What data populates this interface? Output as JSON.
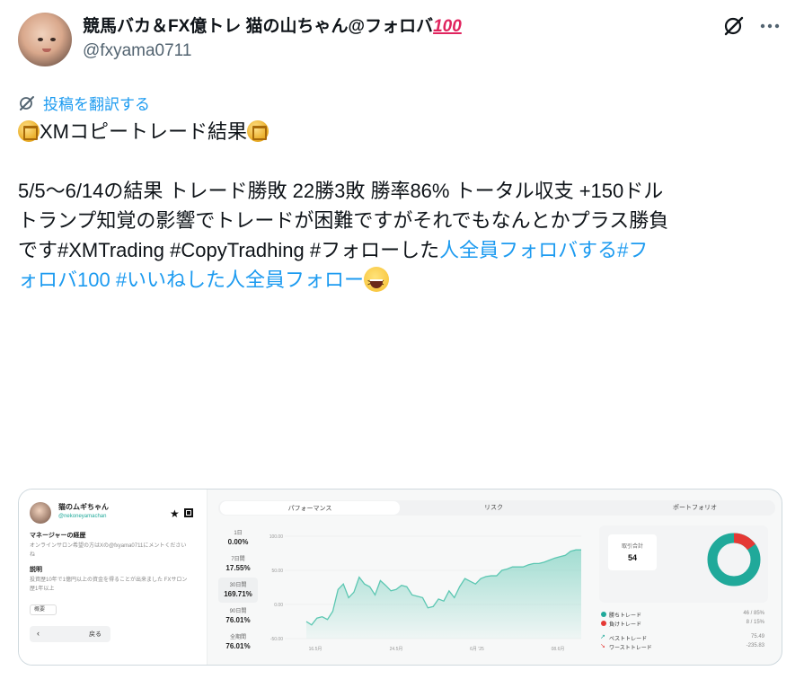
{
  "author": {
    "display_name": "競馬バカ＆FX億トレ 猫の山ちゃん@フォロバ",
    "hundred_emoji": "100",
    "handle": "@fxyama0711"
  },
  "actions": {
    "grok_icon": "grok-icon",
    "more_icon": "more-icon"
  },
  "translate": {
    "label": "投稿を翻訳する"
  },
  "tweet": {
    "line1": "XMコピートレード結果",
    "line2": "5/5〜6/14の結果 トレード勝敗 22勝3敗 勝率86% トータル収支 +150ドル",
    "line3": "トランプ知覚の影響でトレードが困難ですがそれでもなんとかプラス勝負",
    "line4_plain": "です#XMTrading #CopyTradhing #フォローした",
    "line4_link": "人全員フォロバする#フ",
    "line5_link": "ォロバ100 #いいねした人全員フォロー"
  },
  "media": {
    "profile": {
      "name": "猫のムギちゃん",
      "handle": "@nekoneyamachan",
      "h1": "マネージャーの経歴",
      "p1": "オンラインサロン希望の方はXの@fxyama0711にメントくださいね",
      "h2": "説明",
      "p2": "投資歴10年で1億円以上の資金を得ることが出来ました FXサロン歴1年以上",
      "tag": "概要",
      "back_label": "戻る"
    },
    "tabs": [
      "パフォーマンス",
      "リスク",
      "ポートフォリオ"
    ],
    "periods": [
      {
        "label": "1日",
        "value": "0.00%"
      },
      {
        "label": "7日間",
        "value": "17.55%"
      },
      {
        "label": "30日間",
        "value": "169.71%"
      },
      {
        "label": "90日間",
        "value": "76.01%"
      },
      {
        "label": "全期間",
        "value": "76.01%"
      }
    ],
    "stats": {
      "total_label": "取引合計",
      "total_value": "54",
      "win_label": "勝ちトレード",
      "win_value": "46 / 85%",
      "lose_label": "負けトレード",
      "lose_value": "8 / 15%",
      "best_label": "ベストトレード",
      "best_value": "75.49",
      "worst_label": "ワーストトレード",
      "worst_value": "-235.83",
      "win_color": "#20a99a",
      "lose_color": "#e53935"
    }
  },
  "chart_data": {
    "type": "area",
    "title": "",
    "xlabel": "",
    "ylabel": "",
    "y_tick_labels": [
      "100.00",
      "50.00",
      "0.00",
      "-50.00"
    ],
    "y_ticks": [
      100,
      50,
      0,
      -50
    ],
    "ylim": [
      -50,
      100
    ],
    "x_tick_labels": [
      "16.5月",
      "24.5月",
      "6月 '25",
      "08.6月"
    ],
    "series": [
      {
        "color": "#5cc7b2",
        "values": [
          -25,
          -30,
          -20,
          -18,
          -22,
          -10,
          22,
          30,
          10,
          18,
          40,
          30,
          26,
          14,
          35,
          28,
          20,
          22,
          28,
          26,
          14,
          12,
          10,
          -5,
          -3,
          8,
          5,
          20,
          10,
          26,
          38,
          34,
          30,
          38,
          41,
          42,
          42,
          50,
          52,
          55,
          55,
          55,
          58,
          60,
          60,
          62,
          65,
          68,
          70,
          72,
          78,
          80,
          80
        ]
      }
    ],
    "grid": true
  }
}
